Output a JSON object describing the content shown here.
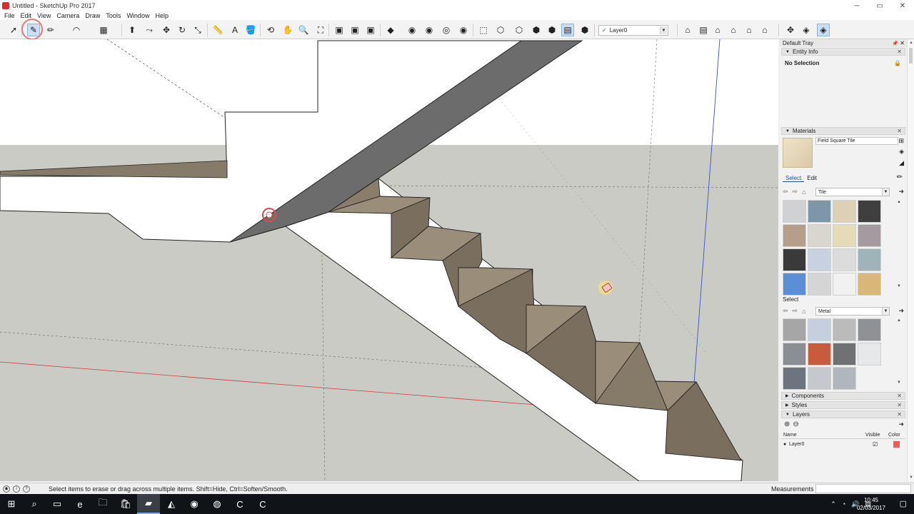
{
  "window": {
    "title": "Untitled - SketchUp Pro 2017",
    "controls": [
      "─",
      "▭",
      "✕"
    ]
  },
  "menu": {
    "items": [
      "File",
      "Edit",
      "View",
      "Camera",
      "Draw",
      "Tools",
      "Window",
      "Help"
    ]
  },
  "toolbar": {
    "layer_check": "✓",
    "layer_selected": "Layer0",
    "icons": [
      {
        "name": "select-icon",
        "glyph": "➚"
      },
      {
        "name": "eraser-icon",
        "glyph": "✎",
        "active": true
      },
      {
        "name": "pencil-line-icon",
        "glyph": "✏"
      },
      {
        "name": "arc-icon",
        "glyph": "◠"
      },
      {
        "name": "rectangle-icon",
        "glyph": "▦"
      },
      {
        "name": "push-pull-icon",
        "glyph": "⬆"
      },
      {
        "name": "follow-me-icon",
        "glyph": "⤳"
      },
      {
        "name": "move-icon",
        "glyph": "✥"
      },
      {
        "name": "rotate-icon",
        "glyph": "↻"
      },
      {
        "name": "scale-icon",
        "glyph": "⤡"
      },
      {
        "name": "tape-measure-icon",
        "glyph": "📏"
      },
      {
        "name": "text-icon",
        "glyph": "A"
      },
      {
        "name": "paint-bucket-icon",
        "glyph": "🪣"
      },
      {
        "name": "orbit-icon",
        "glyph": "⟲"
      },
      {
        "name": "pan-icon",
        "glyph": "✋"
      },
      {
        "name": "zoom-icon",
        "glyph": "🔍"
      },
      {
        "name": "zoom-extents-icon",
        "glyph": "⛶"
      },
      {
        "name": "warehouse-icon",
        "glyph": "▣"
      },
      {
        "name": "share-model-icon",
        "glyph": "▣"
      },
      {
        "name": "extension-warehouse-icon",
        "glyph": "▣"
      },
      {
        "name": "ruby-icon",
        "glyph": "◆"
      },
      {
        "name": "solid-union-icon",
        "glyph": "◉"
      },
      {
        "name": "solid-subtract-icon",
        "glyph": "◉"
      },
      {
        "name": "solid-trim-icon",
        "glyph": "◎"
      },
      {
        "name": "solid-split-icon",
        "glyph": "◉"
      },
      {
        "name": "xray-icon",
        "glyph": "⬚"
      },
      {
        "name": "back-edges-icon",
        "glyph": "⬡"
      },
      {
        "name": "wireframe-icon",
        "glyph": "⬡"
      },
      {
        "name": "hidden-line-icon",
        "glyph": "⬢"
      },
      {
        "name": "shaded-icon",
        "glyph": "⬢"
      },
      {
        "name": "shaded-textures-icon",
        "glyph": "▤",
        "active": true
      },
      {
        "name": "monochrome-icon",
        "glyph": "⬢"
      },
      {
        "name": "iso-view-icon",
        "glyph": "⌂"
      },
      {
        "name": "top-view-icon",
        "glyph": "▤"
      },
      {
        "name": "front-view-icon",
        "glyph": "⌂"
      },
      {
        "name": "right-view-icon",
        "glyph": "⌂"
      },
      {
        "name": "back-view-icon",
        "glyph": "⌂"
      },
      {
        "name": "left-view-icon",
        "glyph": "⌂"
      },
      {
        "name": "section-plane-icon",
        "glyph": "✥"
      },
      {
        "name": "display-section-icon",
        "glyph": "◈"
      },
      {
        "name": "section-cuts-icon",
        "glyph": "◈",
        "active": true
      }
    ]
  },
  "tray": {
    "title": "Default Tray",
    "entity_info": {
      "heading": "Entity Info",
      "selection": "No Selection"
    },
    "materials": {
      "heading": "Materials",
      "current_name": "Field Square Tile",
      "tabs": [
        "Select",
        "Edit"
      ],
      "active_tab": "Select",
      "collection_1": "Tile",
      "collection_2": "Metal",
      "select_label": "Select",
      "tile_swatches": [
        "#cfd1d2",
        "#7d97a9",
        "#ddd0b4",
        "#3f3f3f",
        "#b79e8b",
        "#d9d6cf",
        "#e5dbb8",
        "#a59aa0",
        "#3a3a3a",
        "#c7d1e0",
        "#dcdcdc",
        "#9fb4b8",
        "#5a8fd8",
        "#d5d5d5",
        "#f1f1f1",
        "#d9b77a"
      ],
      "metal_swatches": [
        "#a6a6a6",
        "#c6cfdd",
        "#bbbbbb",
        "#8e9296",
        "#8a8f95",
        "#c75b3d",
        "#6f7172",
        "#e6e8ea",
        "#6c7480",
        "#c5c9ce",
        "#b1b6bc"
      ]
    },
    "components": {
      "heading": "Components"
    },
    "styles": {
      "heading": "Styles"
    },
    "layers": {
      "heading": "Layers",
      "columns": [
        "Name",
        "Visible",
        "Color"
      ],
      "rows": [
        {
          "name": "Layer0",
          "visible": "☑",
          "color": "#ee5a55"
        }
      ]
    }
  },
  "status": {
    "message": "Select items to erase or drag across multiple items. Shift=Hide, Ctrl=Soften/Smooth.",
    "measurements_label": "Measurements"
  },
  "taskbar": {
    "clock_time": "10:45",
    "clock_date": "02/03/2017",
    "apps": [
      {
        "name": "start-icon",
        "glyph": "⊞"
      },
      {
        "name": "search-icon",
        "glyph": "⌕"
      },
      {
        "name": "task-view-icon",
        "glyph": "▭"
      },
      {
        "name": "edge-icon",
        "glyph": "e"
      },
      {
        "name": "file-explorer-icon",
        "glyph": "🗀"
      },
      {
        "name": "store-icon",
        "glyph": "🛍"
      },
      {
        "name": "sketchup-icon",
        "glyph": "▰",
        "selected": true
      },
      {
        "name": "layout-icon",
        "glyph": "◭"
      },
      {
        "name": "firefox-icon",
        "glyph": "◉"
      },
      {
        "name": "chrome-icon",
        "glyph": "◍"
      },
      {
        "name": "camtasia-green-icon",
        "glyph": "C"
      },
      {
        "name": "camtasia-red-icon",
        "glyph": "C"
      }
    ]
  }
}
